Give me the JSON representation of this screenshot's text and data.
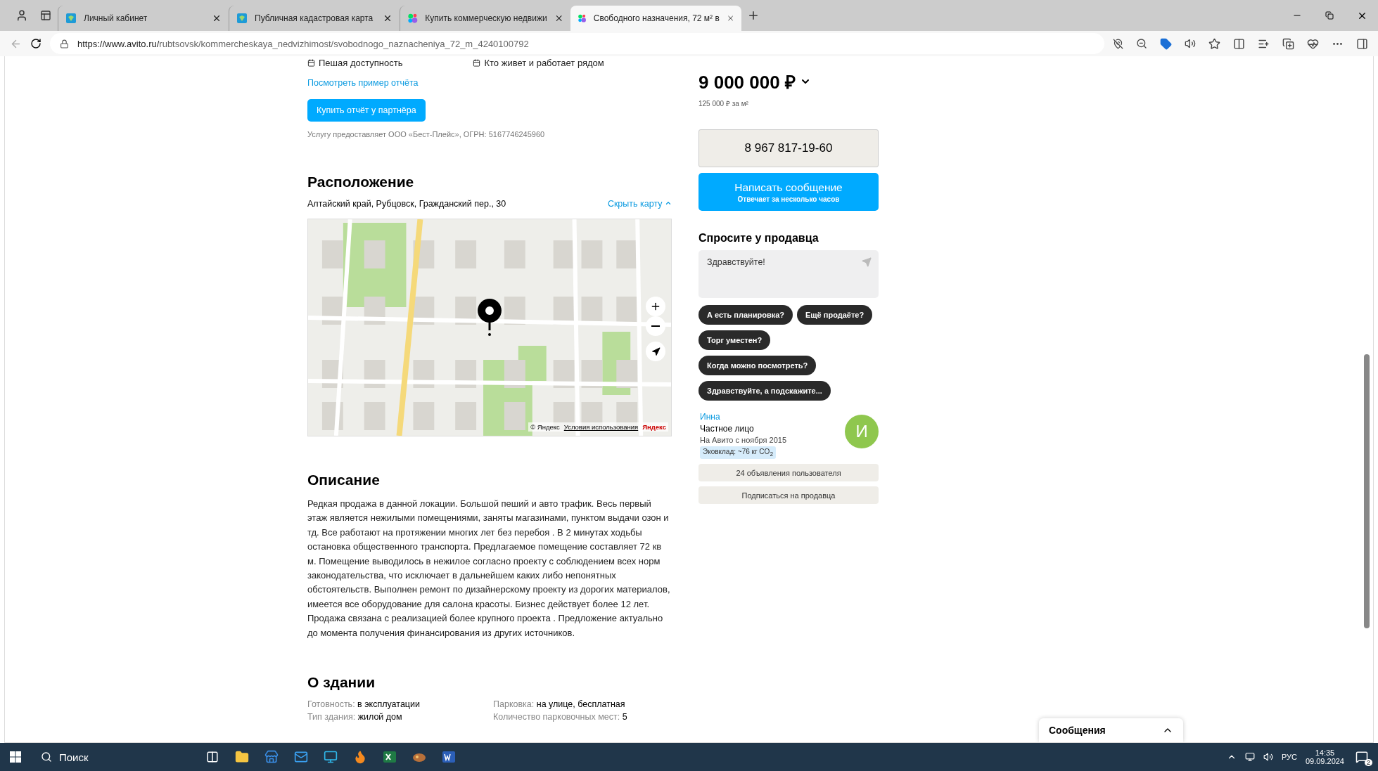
{
  "browser": {
    "tabs": [
      {
        "title": "Личный кабинет",
        "kind": "shield",
        "selected": false
      },
      {
        "title": "Публичная кадастровая карта",
        "kind": "shield",
        "selected": false
      },
      {
        "title": "Купить коммерческую недвижи",
        "kind": "dots",
        "selected": false
      },
      {
        "title": "Свободного назначения, 72 м² в",
        "kind": "dots",
        "selected": true
      }
    ],
    "url": {
      "host": "https://www.avito.ru/",
      "path": "rubtsovsk/kommercheskaya_nedvizhimost/svobodnogo_naznacheniya_72_m_4240100792"
    }
  },
  "report": {
    "features": [
      "Пешая доступность",
      "Кто живет и работает рядом"
    ],
    "sample_link": "Посмотреть пример отчёта",
    "buy_button": "Купить отчёт у партнёра",
    "provider": "Услугу предоставляет ООО «Бест-Плейс», ОГРН: 5167746245960"
  },
  "location": {
    "heading": "Расположение",
    "address": "Алтайский край, Рубцовск, Гражданский пер., 30",
    "hide_map": "Скрыть карту",
    "map": {
      "copyright": "© Яндекс",
      "terms": "Условия использования",
      "logo": "Яндекс"
    }
  },
  "description": {
    "heading": "Описание",
    "text": "Редкая продажа в данной локации. Большой пеший и авто трафик. Весь первый этаж является нежилыми помещениями, заняты магазинами, пунктом выдачи озон и тд. Все работают на протяжении многих лет без перебоя . В 2 минутах ходьбы остановка общественного транспорта. Предлагаемое помещение составляет 72 кв м. Помещение выводилось в нежилое согласно проекту с соблюдением всех норм законодательства, что исключает в дальнейшем каких либо непонятных обстоятельств. Выполнен ремонт по дизайнерскому проекту из дорогих материалов, имеется все оборудование для салона красоты. Бизнес действует более 12 лет. Продажа связана с реализацией более крупного проекта . Предложение актуально до момента получения финансирования из других источников."
  },
  "building": {
    "heading": "О здании",
    "params": [
      {
        "label": "Готовность:",
        "value": "в эксплуатации"
      },
      {
        "label": "Парковка:",
        "value": "на улице, бесплатная"
      },
      {
        "label": "Тип здания:",
        "value": "жилой дом"
      },
      {
        "label": "Количество парковочных мест:",
        "value": "5"
      }
    ]
  },
  "sidebar": {
    "price": "9 000 000 ₽",
    "price_per_m2": "125 000 ₽ за м²",
    "phone": "8 967 817-19-60",
    "message_button": {
      "label": "Написать сообщение",
      "sub": "Отвечает за несколько часов"
    },
    "ask": {
      "heading": "Спросите у продавца",
      "value": "Здравствуйте!",
      "chips": [
        [
          "А есть планировка?",
          "Ещё продаёте?"
        ],
        [
          "Торг уместен?"
        ],
        [
          "Когда можно посмотреть?"
        ],
        [
          "Здравствуйте, а подскажите..."
        ]
      ]
    },
    "seller": {
      "name": "Инна",
      "type": "Частное лицо",
      "since": "На Авито с ноября 2015",
      "eco": "Эковклад: ~76 кг CO$_{2}$",
      "avatar_letter": "И"
    },
    "ads_button": "24 объявления пользователя",
    "subscribe_button": "Подписаться на продавца"
  },
  "messages_widget": {
    "title": "Сообщения"
  },
  "taskbar": {
    "search": "Поиск",
    "language": "РУС",
    "time": "14:35",
    "date": "09.09.2024",
    "notifications": "2"
  }
}
